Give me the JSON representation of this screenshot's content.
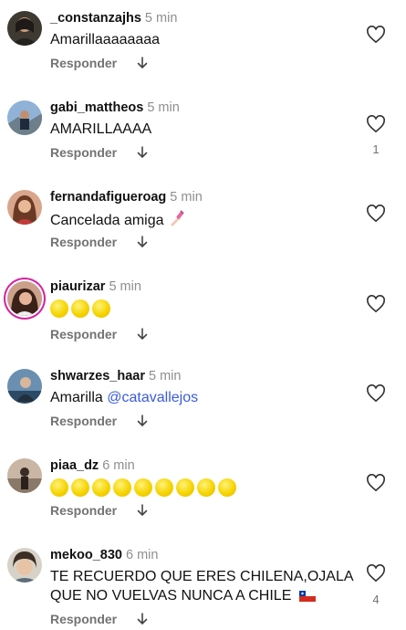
{
  "comments": [
    {
      "username": "_constanzajhs",
      "time": "5 min",
      "text": "Amarillaaaaaaaa",
      "reply": "Responder",
      "likes": ""
    },
    {
      "username": "gabi_mattheos",
      "time": "5 min",
      "text": "AMARILLAAAA",
      "reply": "Responder",
      "likes": "1"
    },
    {
      "username": "fernandafigueroag",
      "time": "5 min",
      "text": "Cancelada amiga",
      "reply": "Responder",
      "likes": ""
    },
    {
      "username": "piaurizar",
      "time": "5 min",
      "yellow_circles": 3,
      "reply": "Responder",
      "likes": ""
    },
    {
      "username": "shwarzes_haar",
      "time": "5 min",
      "text": "Amarilla",
      "mention": "@catavallejos",
      "reply": "Responder",
      "likes": ""
    },
    {
      "username": "piaa_dz",
      "time": "6 min",
      "yellow_circles": 9,
      "reply": "Responder",
      "likes": ""
    },
    {
      "username": "mekoo_830",
      "time": "6 min",
      "text_line1": "TE RECUERDO QUE ERES CHILENA,OJALA",
      "text_line2": "QUE NO VUELVAS NUNCA A CHILE",
      "reply": "Responder",
      "likes": "4"
    }
  ],
  "icons": {
    "like": "heart-outline-icon",
    "reply": "arrow-down-icon",
    "nails": "nail-polish-emoji",
    "flag": "chile-flag-emoji"
  }
}
